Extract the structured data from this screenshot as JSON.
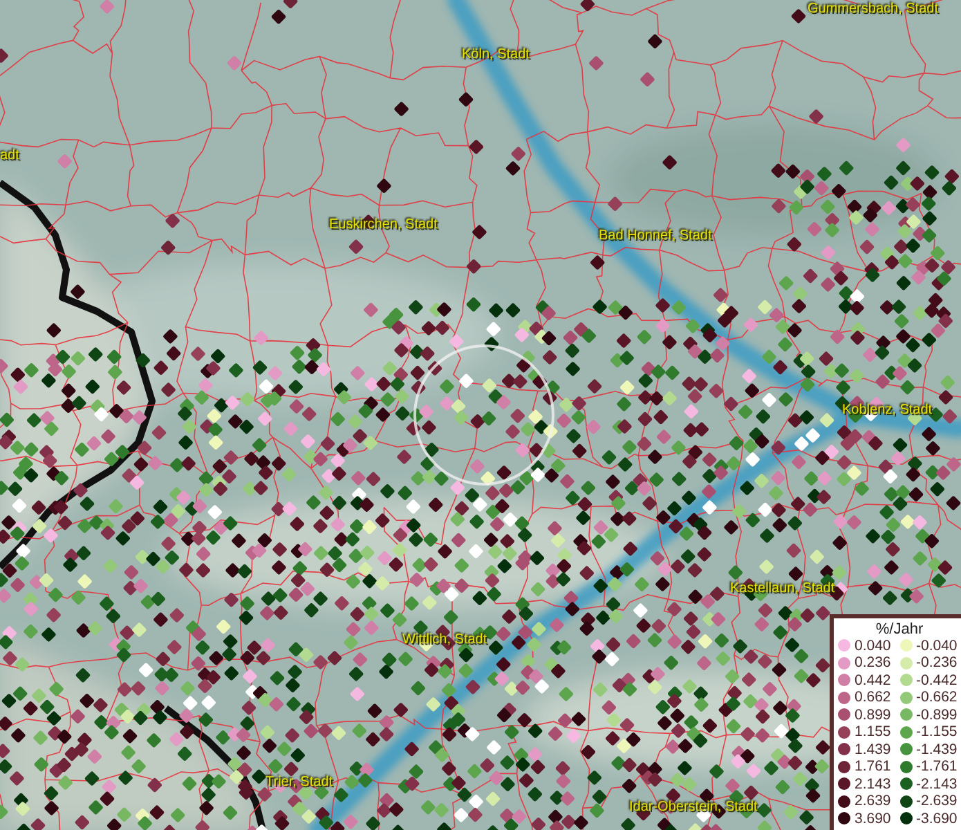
{
  "map": {
    "place_labels": [
      {
        "text": "Gummersbach, Stadt"
      },
      {
        "text": "Köln, Stadt"
      },
      {
        "text": "adt"
      },
      {
        "text": "Euskirchen, Stadt"
      },
      {
        "text": "Bad Honnef, Stadt"
      },
      {
        "text": "Koblenz, Stadt"
      },
      {
        "text": "Kastellaun, Stadt"
      },
      {
        "text": "Wittlich, Stadt"
      },
      {
        "text": "Trier, Stadt"
      },
      {
        "text": "Idar-Oberstein, Stadt"
      }
    ]
  },
  "legend": {
    "title": "%/Jahr",
    "rows": [
      {
        "positive": {
          "value": "0.040",
          "color": "#f5b8e0"
        },
        "negative": {
          "value": "-0.040",
          "color": "#eef7b8"
        }
      },
      {
        "positive": {
          "value": "0.236",
          "color": "#e39ac4"
        },
        "negative": {
          "value": "-0.236",
          "color": "#d4ebaa"
        }
      },
      {
        "positive": {
          "value": "0.442",
          "color": "#d07fa6"
        },
        "negative": {
          "value": "-0.442",
          "color": "#b3db90"
        }
      },
      {
        "positive": {
          "value": "0.662",
          "color": "#bd6689"
        },
        "negative": {
          "value": "-0.662",
          "color": "#94c97a"
        }
      },
      {
        "positive": {
          "value": "0.899",
          "color": "#a94f6f"
        },
        "negative": {
          "value": "-0.899",
          "color": "#78b862"
        }
      },
      {
        "positive": {
          "value": "1.155",
          "color": "#96405a"
        },
        "negative": {
          "value": "-1.155",
          "color": "#5ea64e"
        }
      },
      {
        "positive": {
          "value": "1.439",
          "color": "#83304a"
        },
        "negative": {
          "value": "-1.439",
          "color": "#47933e"
        }
      },
      {
        "positive": {
          "value": "1.761",
          "color": "#6e2336"
        },
        "negative": {
          "value": "-1.761",
          "color": "#2f7a2c"
        }
      },
      {
        "positive": {
          "value": "2.143",
          "color": "#5a1626"
        },
        "negative": {
          "value": "-2.143",
          "color": "#1c6020"
        }
      },
      {
        "positive": {
          "value": "2.639",
          "color": "#440b18"
        },
        "negative": {
          "value": "-2.639",
          "color": "#0f4515"
        }
      },
      {
        "positive": {
          "value": "3.690",
          "color": "#2e0710"
        },
        "negative": {
          "value": "-3.690",
          "color": "#05300c"
        }
      }
    ]
  }
}
